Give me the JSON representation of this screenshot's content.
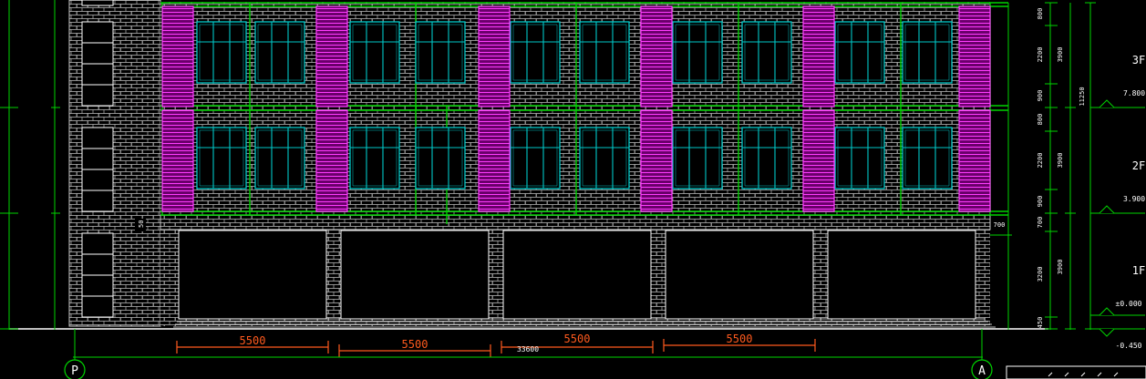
{
  "colors": {
    "background": "#000000",
    "frame_green": "#00d400",
    "brick": "#c8c8c8",
    "window_cyan": "#00c8c8",
    "louver_magenta": "#d000d0",
    "dimension_red": "#ff5a1e",
    "text_white": "#ffffff",
    "door_white": "#ffffff"
  },
  "dimensions": {
    "bay": [
      "5500",
      "5500",
      "5500",
      "5500"
    ],
    "total_width": "33600",
    "slab_note": "50",
    "canopy_note": "700",
    "right_col_1": [
      "800",
      "2200",
      "900",
      "800",
      "2200",
      "900",
      "700",
      "3200",
      "450"
    ],
    "right_col_2": [
      "3900",
      "3900",
      "3900"
    ],
    "overall_height": "11250"
  },
  "levels": {
    "floor_labels": [
      "3F",
      "2F",
      "1F"
    ],
    "elevations": [
      "7.800",
      "3.900",
      "±0.000",
      "-0.450"
    ]
  },
  "axes": {
    "left": "P",
    "right": "A"
  }
}
